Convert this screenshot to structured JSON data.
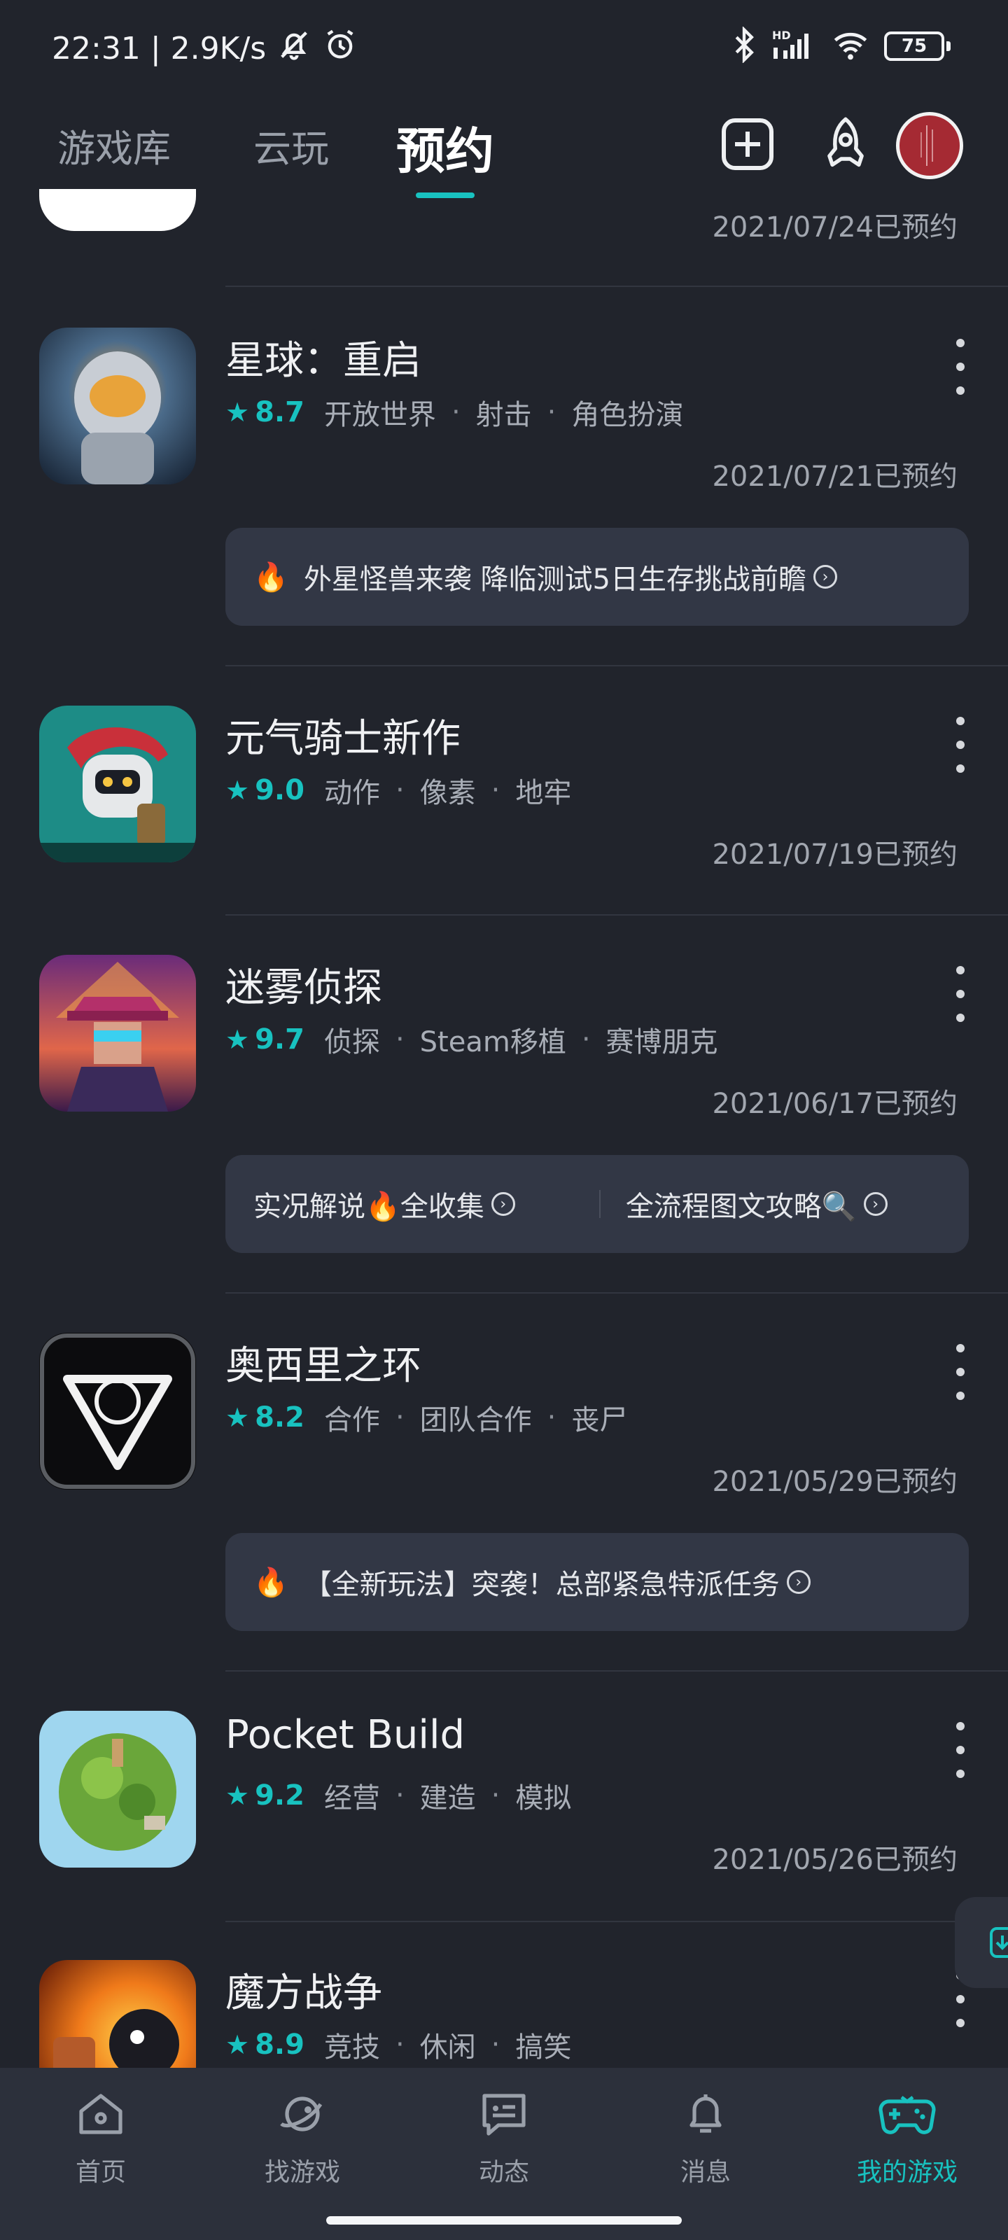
{
  "status_bar": {
    "time": "22:31",
    "separator": "|",
    "net_speed": "2.9K/s",
    "battery": "75",
    "icons": [
      "mute-icon",
      "alarm-icon",
      "bluetooth-icon",
      "hd-signal-icon",
      "wifi-icon",
      "battery-icon"
    ]
  },
  "top_nav": {
    "tabs": [
      {
        "label": "游戏库",
        "active": false
      },
      {
        "label": "云玩",
        "active": false
      },
      {
        "label": "预约",
        "active": true
      }
    ],
    "icons": [
      "add-icon",
      "rocket-icon",
      "avatar"
    ],
    "accent_color": "#18c2c0"
  },
  "partial_item": {
    "date": "2021/07/24已预约"
  },
  "games": [
    {
      "title": "星球：重启",
      "score": "8.7",
      "tags": [
        "开放世界",
        "射击",
        "角色扮演"
      ],
      "date": "2021/07/21已预约",
      "news": [
        {
          "text": "外星怪兽来袭 降临测试5日生存挑战前瞻",
          "fire": true
        }
      ]
    },
    {
      "title": "元气骑士新作",
      "score": "9.0",
      "tags": [
        "动作",
        "像素",
        "地牢"
      ],
      "date": "2021/07/19已预约",
      "news": []
    },
    {
      "title": "迷雾侦探",
      "score": "9.7",
      "tags": [
        "侦探",
        "Steam移植",
        "赛博朋克"
      ],
      "date": "2021/06/17已预约",
      "news": [
        {
          "text": "实况解说🔥全收集",
          "fire": false
        },
        {
          "text": "全流程图文攻略🔍",
          "fire": false
        }
      ]
    },
    {
      "title": "奥西里之环",
      "score": "8.2",
      "tags": [
        "合作",
        "团队合作",
        "丧尸"
      ],
      "date": "2021/05/29已预约",
      "news": [
        {
          "text": "【全新玩法】突袭！总部紧急特派任务",
          "fire": true
        }
      ]
    },
    {
      "title": "Pocket Build",
      "score": "9.2",
      "tags": [
        "经营",
        "建造",
        "模拟"
      ],
      "date": "2021/05/26已预约",
      "news": []
    },
    {
      "title": "魔方战争",
      "score": "8.9",
      "tags": [
        "竞技",
        "休闲",
        "搞笑"
      ],
      "date": "",
      "news": []
    }
  ],
  "bottom_nav": {
    "items": [
      {
        "label": "首页",
        "icon": "home-icon",
        "active": false
      },
      {
        "label": "找游戏",
        "icon": "planet-icon",
        "active": false
      },
      {
        "label": "动态",
        "icon": "chat-icon",
        "active": false
      },
      {
        "label": "消息",
        "icon": "bell-icon",
        "active": false
      },
      {
        "label": "我的游戏",
        "icon": "gamepad-icon",
        "active": true
      }
    ]
  }
}
